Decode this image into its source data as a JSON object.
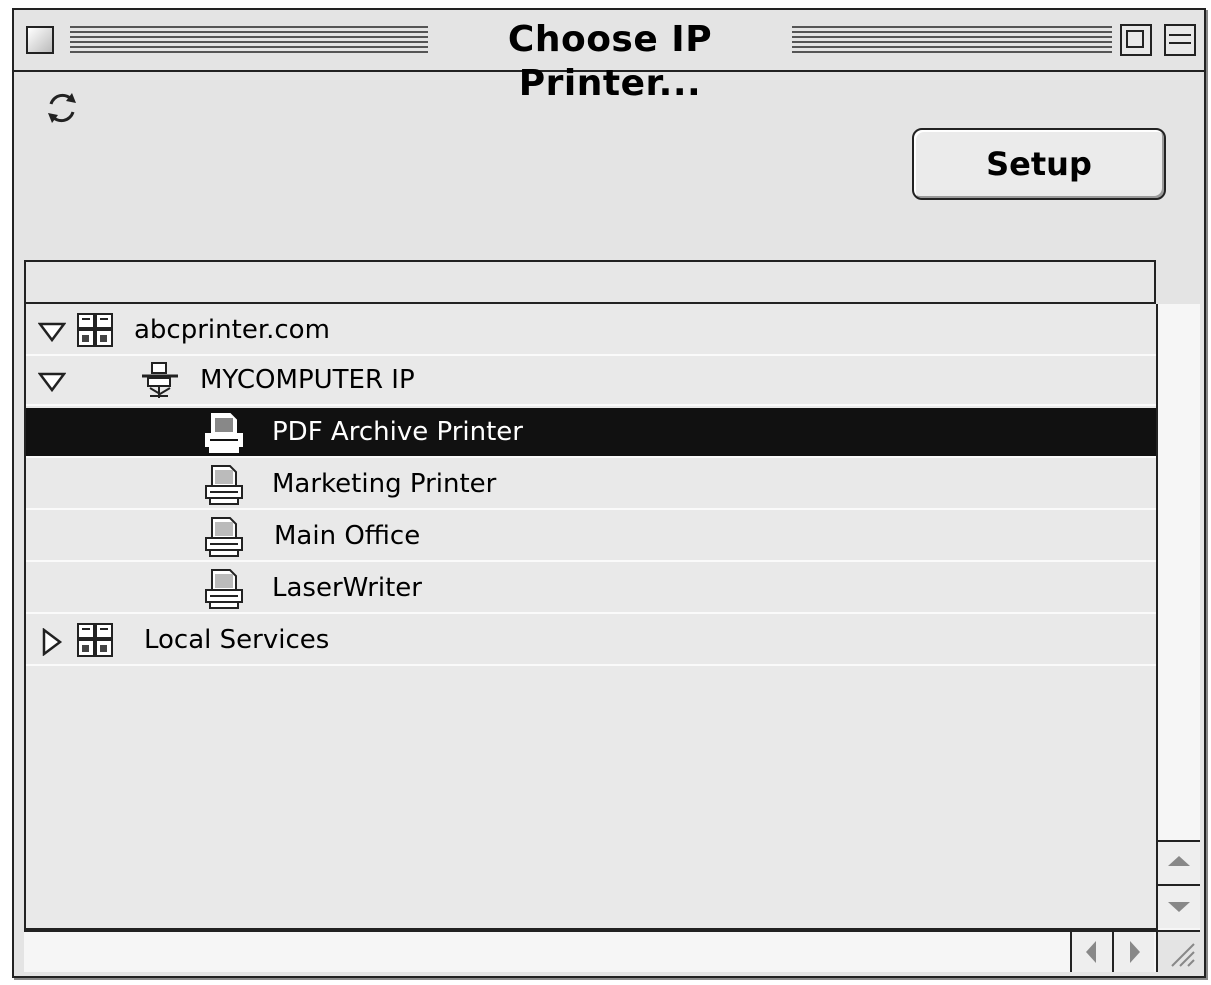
{
  "window": {
    "title": "Choose IP Printer..."
  },
  "toolbar": {
    "refresh_icon": "refresh-icon",
    "setup_label": "Setup"
  },
  "list": {
    "rows": [
      {
        "label": "abcprinter.com",
        "icon": "network-zone-icon",
        "disclosure": "expanded",
        "selected": false
      },
      {
        "label": "MYCOMPUTER IP",
        "icon": "network-printer-host-icon",
        "disclosure": "expanded",
        "selected": false
      },
      {
        "label": "PDF Archive Printer",
        "icon": "printer-icon",
        "disclosure": "none",
        "selected": true
      },
      {
        "label": "Marketing Printer",
        "icon": "printer-icon",
        "disclosure": "none",
        "selected": false
      },
      {
        "label": "Main Office",
        "icon": "printer-icon",
        "disclosure": "none",
        "selected": false
      },
      {
        "label": "LaserWriter",
        "icon": "printer-icon",
        "disclosure": "none",
        "selected": false
      },
      {
        "label": "Local Services",
        "icon": "network-zone-icon",
        "disclosure": "collapsed",
        "selected": false
      }
    ]
  },
  "colors": {
    "window_bg": "#e4e4e4",
    "selection_bg": "#111111",
    "selection_text": "#ffffff"
  }
}
